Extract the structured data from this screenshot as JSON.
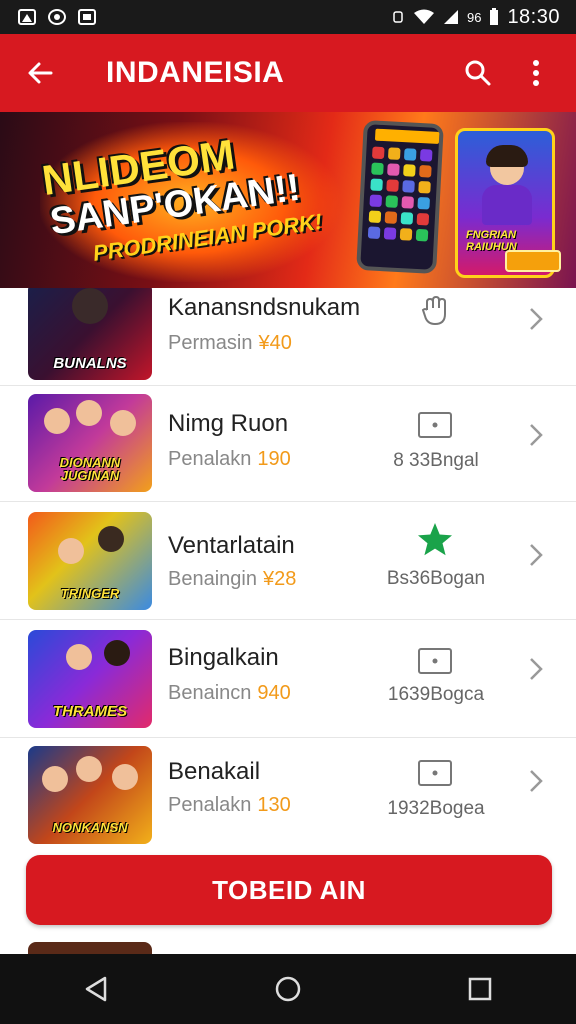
{
  "status_bar": {
    "time": "18:30",
    "sim_indicator": "96",
    "left_icons": [
      "notification-icon",
      "media-icon",
      "screenshot-icon"
    ]
  },
  "app_bar": {
    "title": "INDANEISIA",
    "actions": [
      "search-icon",
      "more-vert-icon"
    ]
  },
  "banner": {
    "headline_line1": "NLIDEOM",
    "headline_line2": "SANP'OKAN!!",
    "headline_line3": "PRODRINEIAN PORK!",
    "promo_text": "FNGRIAN RAIUHUN"
  },
  "games": [
    {
      "thumb_title": "BUNALNS",
      "title": "Kanansndsnukam",
      "subtitle": "Permasin",
      "count": "¥40",
      "icon": "hand-icon",
      "meta": ""
    },
    {
      "thumb_title": "DIONANN JUGINAN",
      "title": "Nimg Ruon",
      "subtitle": "Penalakn",
      "count": "190",
      "icon": "screen-icon",
      "meta": "8 33Bngal"
    },
    {
      "thumb_title": "TRINGER",
      "title": "Ventarlatain",
      "subtitle": "Benaingin",
      "count": "¥28",
      "icon": "star-icon",
      "meta": "Bs36Bogan"
    },
    {
      "thumb_title": "THRAMES",
      "title": "Bingalkain",
      "subtitle": "Benaincn",
      "count": "940",
      "icon": "screen-icon",
      "meta": "1639Bogca"
    },
    {
      "thumb_title": "NONKANSN",
      "title": "Benakail",
      "subtitle": "Penalakn",
      "count": "130",
      "icon": "screen-icon",
      "meta": "1932Bogea"
    }
  ],
  "cta": {
    "label": "TOBEID AIN"
  },
  "colors": {
    "primary": "#d71920",
    "accent": "#f29a1a",
    "star": "#1aa34a"
  },
  "nav": [
    "back-nav-icon",
    "home-nav-icon",
    "recents-nav-icon"
  ]
}
